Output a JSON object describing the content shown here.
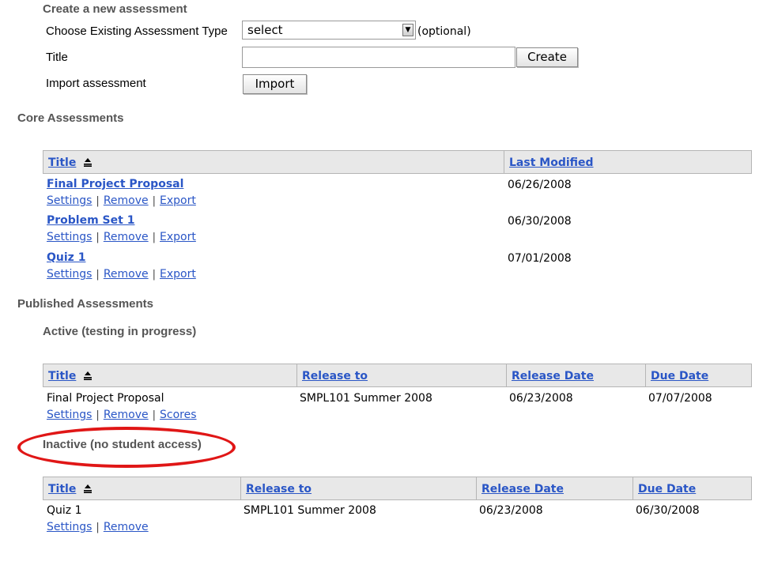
{
  "create": {
    "heading": "Create a new assessment",
    "type_label": "Choose Existing Assessment Type",
    "type_select_value": "select",
    "optional_text": "(optional)",
    "title_label": "Title",
    "title_value": "",
    "create_button": "Create",
    "import_label": "Import assessment",
    "import_button": "Import"
  },
  "core": {
    "heading": "Core Assessments",
    "columns": [
      "Title",
      "Last Modified"
    ],
    "rows": [
      {
        "title": "Final Project Proposal",
        "modified": "06/26/2008",
        "actions": [
          "Settings",
          "Remove",
          "Export"
        ]
      },
      {
        "title": "Problem Set 1",
        "modified": "06/30/2008",
        "actions": [
          "Settings",
          "Remove",
          "Export"
        ]
      },
      {
        "title": "Quiz 1",
        "modified": "07/01/2008",
        "actions": [
          "Settings",
          "Remove",
          "Export"
        ]
      }
    ]
  },
  "published": {
    "heading": "Published Assessments",
    "active": {
      "heading": "Active (testing in progress)",
      "columns": [
        "Title",
        "Release to",
        "Release Date",
        "Due Date"
      ],
      "rows": [
        {
          "title": "Final Project Proposal",
          "release_to": "SMPL101 Summer 2008",
          "release_date": "06/23/2008",
          "due_date": "07/07/2008",
          "actions": [
            "Settings",
            "Remove",
            "Scores"
          ]
        }
      ]
    },
    "inactive": {
      "heading": "Inactive (no student access)",
      "columns": [
        "Title",
        "Release to",
        "Release Date",
        "Due Date"
      ],
      "rows": [
        {
          "title": "Quiz 1",
          "release_to": "SMPL101 Summer 2008",
          "release_date": "06/23/2008",
          "due_date": "06/30/2008",
          "actions": [
            "Settings",
            "Remove"
          ]
        }
      ]
    }
  },
  "colors": {
    "link": "#2a56c6",
    "highlight": "#e01616",
    "header_bg": "#e8e8e8"
  },
  "icons": {
    "sort": "sort-ascending-icon",
    "dropdown": "chevron-down-icon"
  }
}
